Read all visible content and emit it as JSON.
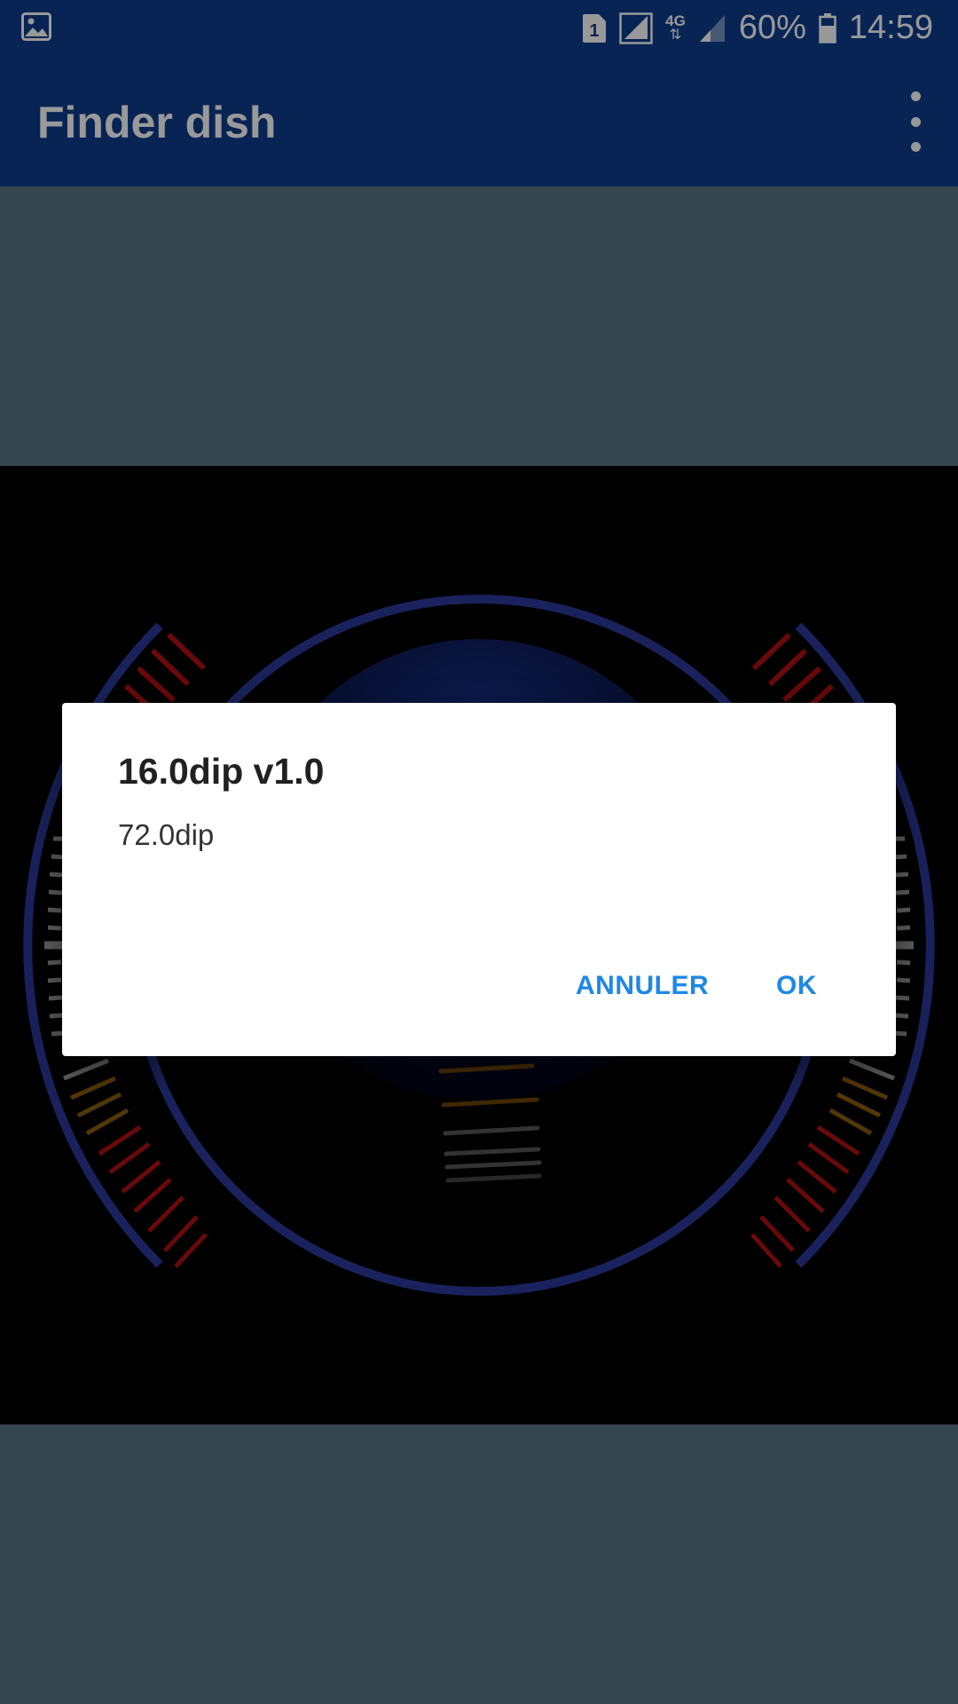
{
  "status_bar": {
    "sim_label": "1",
    "network_label": "4G",
    "battery_percent": "60%",
    "time": "14:59",
    "icons": [
      "gallery-icon",
      "sim-icon",
      "signal-icon",
      "data-arrows-icon",
      "signal-weak-icon",
      "battery-icon"
    ]
  },
  "app_bar": {
    "title": "Finder dish",
    "menu_icon": "overflow-menu-icon"
  },
  "dialog": {
    "title": "16.0dip v1.0",
    "message": "72.0dip",
    "cancel_label": "ANNULER",
    "ok_label": "OK"
  },
  "colors": {
    "primary": "#0c3d8c",
    "panel": "#587582",
    "accent": "#1e88e5",
    "ring": "#2b3a9a"
  }
}
